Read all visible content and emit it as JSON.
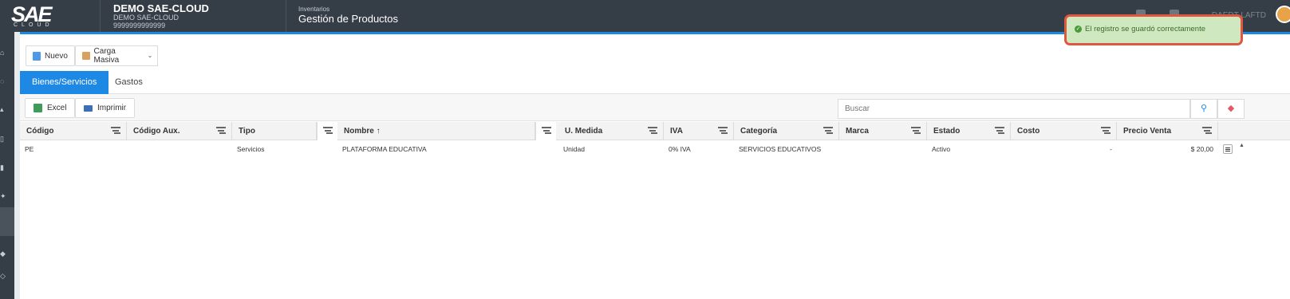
{
  "topbar": {
    "logo_text": "SAE",
    "logo_sub": "CLOUD",
    "company_name": "DEMO SAE-CLOUD",
    "company_sub": "DEMO SAE-CLOUD",
    "company_id": "9999999999999",
    "module_category": "Inventarios",
    "module_title": "Gestión de Productos",
    "user_label": "DAEDT LAFTD"
  },
  "toolbar": {
    "new_label": "Nuevo",
    "bulk_label": "Carga Masiva"
  },
  "tabs": [
    {
      "label": "Bienes/Servicios",
      "active": true
    },
    {
      "label": "Gastos",
      "active": false
    }
  ],
  "grid_toolbar": {
    "excel_label": "Excel",
    "print_label": "Imprimir",
    "search_placeholder": "Buscar"
  },
  "columns": [
    {
      "label": "Código"
    },
    {
      "label": "Código Aux."
    },
    {
      "label": "Tipo"
    },
    {
      "label": "Nombre",
      "sort": "asc"
    },
    {
      "label": "U. Medida"
    },
    {
      "label": "IVA"
    },
    {
      "label": "Categoría"
    },
    {
      "label": "Marca"
    },
    {
      "label": "Estado"
    },
    {
      "label": "Costo"
    },
    {
      "label": "Precio Venta"
    }
  ],
  "rows": [
    {
      "codigo": "PE",
      "codigo_aux": "",
      "tipo": "Servicios",
      "nombre": "PLATAFORMA EDUCATIVA",
      "u_medida": "Unidad",
      "iva": "0% IVA",
      "categoria": "SERVICIOS EDUCATIVOS",
      "marca": "",
      "estado": "Activo",
      "costo": "-",
      "precio_venta": "$ 20,00"
    }
  ],
  "toast": {
    "message": "El registro se guardó correctamente",
    "status_color": "#4a9a3a"
  },
  "colors": {
    "accent": "#1e88e5",
    "topbar": "#353d47"
  }
}
